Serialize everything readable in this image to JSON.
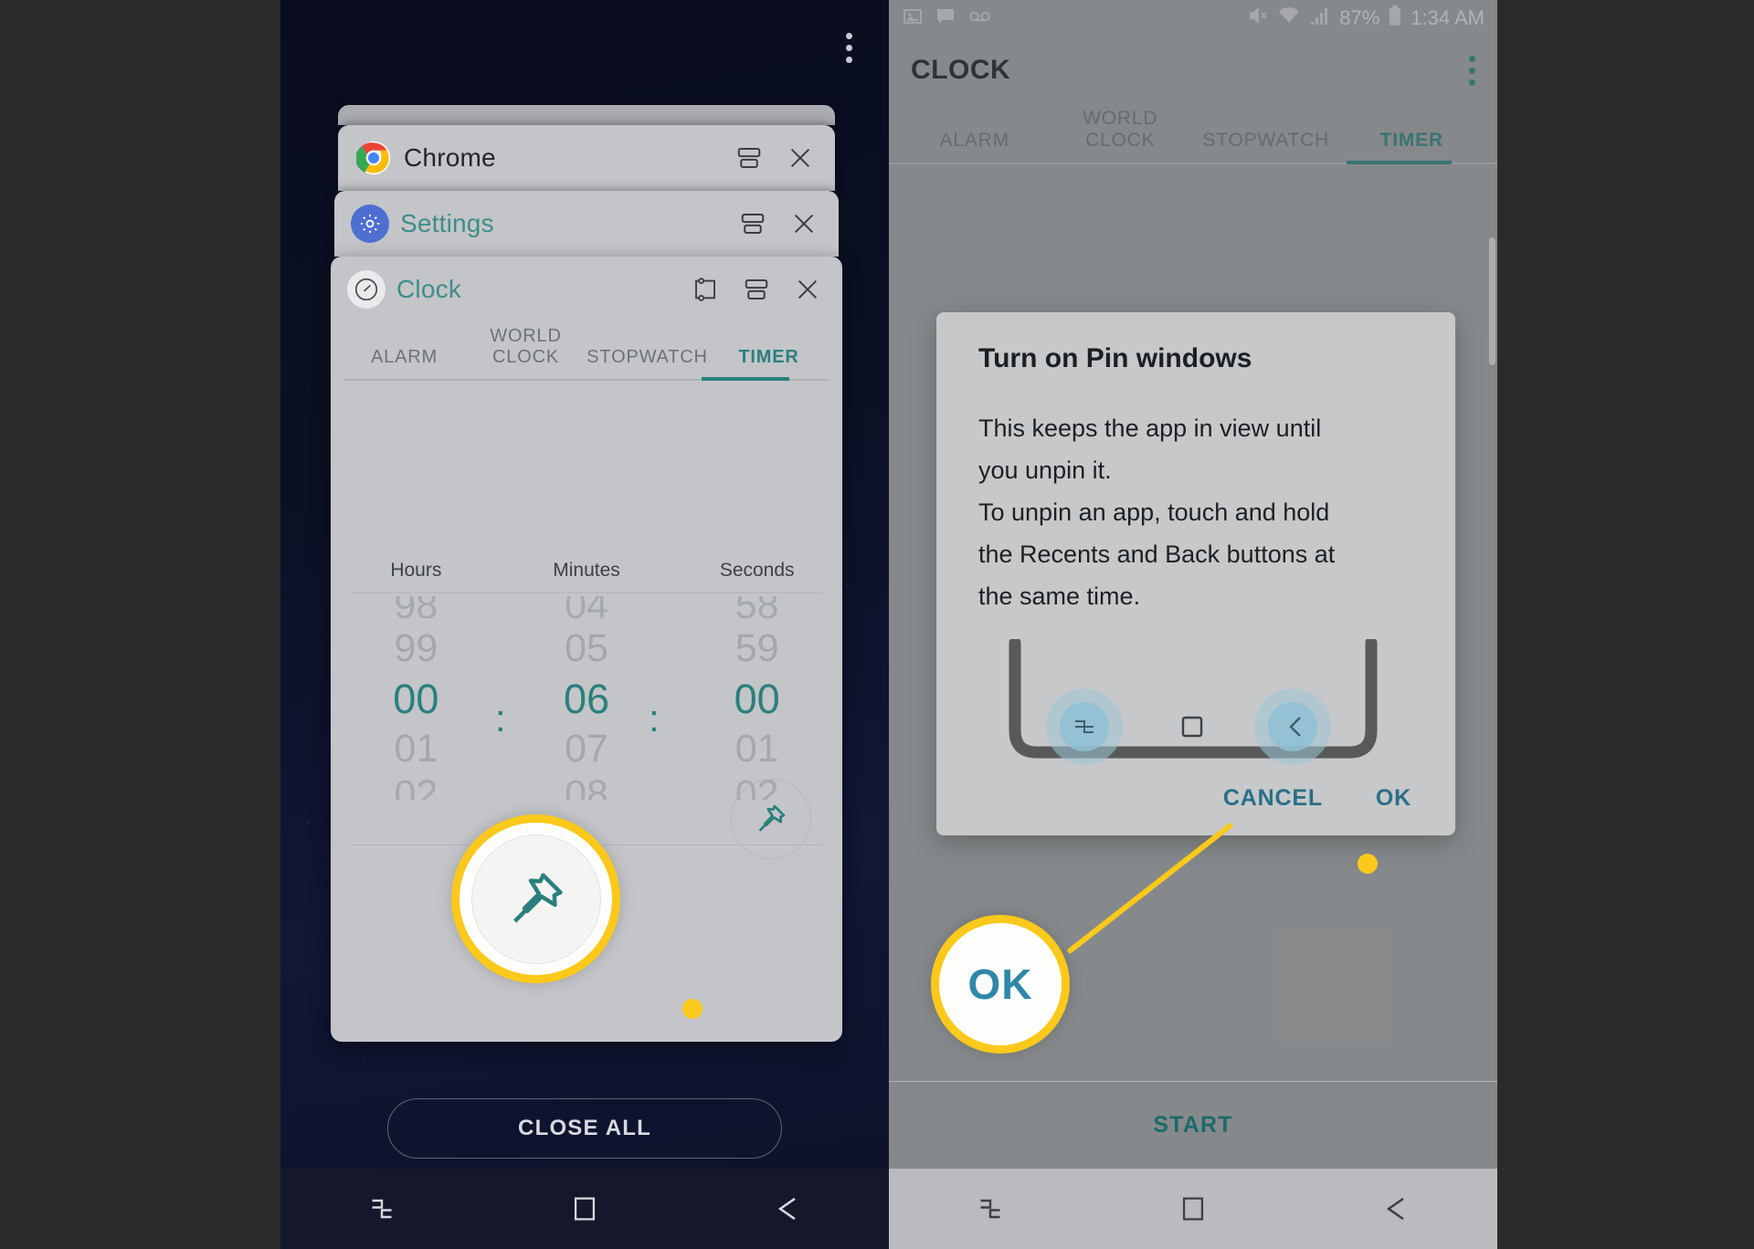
{
  "left_phone": {
    "overflow_menu": "more-options",
    "recents_cards": [
      {
        "app": "Chrome",
        "icon": "chrome-icon",
        "title_color": "#23262b"
      },
      {
        "app": "Settings",
        "icon": "settings-gear-icon",
        "title_color": "#3f8d8a"
      },
      {
        "app": "Clock",
        "icon": "clock-icon",
        "title_color": "#3f8d8a"
      }
    ],
    "card_actions": {
      "pin": "pin-window-icon",
      "split": "split-screen-icon",
      "close": "close-icon"
    },
    "clock": {
      "tabs": [
        "ALARM",
        "WORLD CLOCK",
        "STOPWATCH",
        "TIMER"
      ],
      "active_tab": "TIMER",
      "picker": {
        "labels": [
          "Hours",
          "Minutes",
          "Seconds"
        ],
        "hours": {
          "above2": "98",
          "above1": "99",
          "selected": "00",
          "below1": "01",
          "below2": "02"
        },
        "minutes": {
          "above2": "04",
          "above1": "05",
          "selected": "06",
          "below1": "07",
          "below2": "08"
        },
        "seconds": {
          "above2": "58",
          "above1": "59",
          "selected": "00",
          "below1": "01",
          "below2": "02"
        },
        "separator": ":"
      },
      "pin_button": "pin-window-icon"
    },
    "close_all_label": "CLOSE ALL",
    "navbar": [
      "recents-icon",
      "home-icon",
      "back-icon"
    ],
    "callout": {
      "icon": "pin-window-icon"
    }
  },
  "right_phone": {
    "statusbar": {
      "left_icons": [
        "image-icon",
        "message-icon",
        "voicemail-icon"
      ],
      "mute_icon": "mute-icon",
      "wifi_icon": "wifi-icon",
      "signal_icon": "signal-icon",
      "battery_percent": "87%",
      "battery_icon": "battery-icon",
      "time": "1:34 AM"
    },
    "header": {
      "title": "CLOCK",
      "overflow": "more-options-icon"
    },
    "tabs": [
      "ALARM",
      "WORLD CLOCK",
      "STOPWATCH",
      "TIMER"
    ],
    "active_tab": "TIMER",
    "dialog": {
      "title": "Turn on Pin windows",
      "body_line1": "This keeps the app in view until",
      "body_line2": "you unpin it.",
      "body_line3": "To unpin an app, touch and hold",
      "body_line4": "the Recents and Back buttons at",
      "body_line5": "the same time.",
      "illustration": {
        "recents_icon": "recents-icon",
        "home_icon": "home-icon",
        "back_icon": "back-icon"
      },
      "cancel_label": "CANCEL",
      "ok_label": "OK"
    },
    "start_label": "START",
    "navbar": [
      "recents-icon",
      "home-icon",
      "back-icon"
    ],
    "callout": {
      "label": "OK"
    }
  },
  "colors": {
    "accent_teal": "#2b7f7c",
    "callout_yellow": "#fbc91b",
    "dialog_link": "#2a6f86",
    "callout_text": "#2f87a8"
  }
}
